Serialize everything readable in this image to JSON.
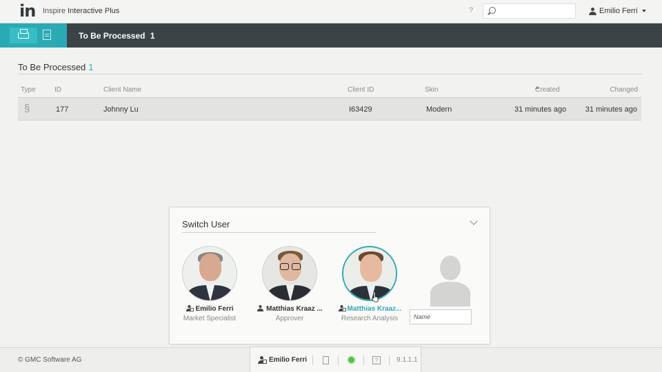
{
  "app": {
    "logo": "in",
    "name_prefix": "Inspire",
    "name_main": "Interactive Plus",
    "help_label": "?",
    "search_placeholder": "",
    "current_user": "Emilio Ferri"
  },
  "navbar": {
    "title": "To Be Processed",
    "count": "1"
  },
  "section": {
    "title": "To Be Processed",
    "count": "1"
  },
  "table": {
    "headers": [
      "Type",
      "ID",
      "Client Name",
      "Client ID",
      "Skin",
      "Created",
      "Changed"
    ],
    "rows": [
      {
        "type": "§",
        "id": "177",
        "client_name": "Johnny Lu",
        "client_id": "I63429",
        "skin": "Modern",
        "created": "31 minutes ago",
        "changed": "31 minutes ago"
      }
    ]
  },
  "switch_user": {
    "title": "Switch User",
    "users": [
      {
        "name": "Emilio Ferri",
        "role": "Market Specialist"
      },
      {
        "name": "Matthias Kraaz ...",
        "role": "Approver"
      },
      {
        "name": "Matthias Kraaz...",
        "role": "Research Analysis"
      }
    ],
    "name_placeholder": "Name"
  },
  "footer": {
    "copyright": "© GMC Software AG",
    "user": "Emilio Ferri",
    "version": "9.1.1.1",
    "help_glyph": "?"
  },
  "colors": {
    "accent": "#2aaab4",
    "header_dark": "#3b4346",
    "status_ok": "#52c24a"
  }
}
